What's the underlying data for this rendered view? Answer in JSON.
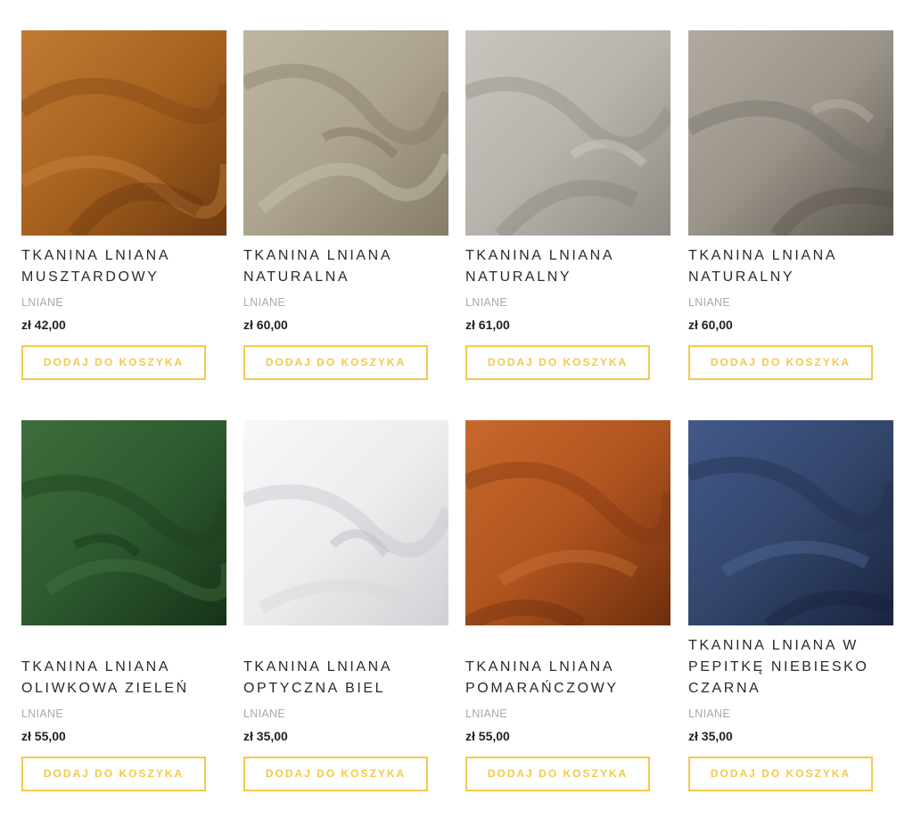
{
  "products": [
    {
      "title": "TKANINA LNIANA MUSZTARDOWY",
      "category": "LNIANE",
      "price": "zł 42,00",
      "button": "DODAJ DO KOSZYKA",
      "color": "#a8621f"
    },
    {
      "title": "TKANINA LNIANA NATURALNA",
      "category": "LNIANE",
      "price": "zł 60,00",
      "button": "DODAJ DO KOSZYKA",
      "color": "#aca48f"
    },
    {
      "title": "TKANINA LNIANA NATURALNY",
      "category": "LNIANE",
      "price": "zł 61,00",
      "button": "DODAJ DO KOSZYKA",
      "color": "#b8b4ad"
    },
    {
      "title": "TKANINA LNIANA NATURALNY",
      "category": "LNIANE",
      "price": "zł 60,00",
      "button": "DODAJ DO KOSZYKA",
      "color": "#9a948a"
    },
    {
      "title": "TKANINA LNIANA OLIWKOWA ZIELEŃ",
      "category": "LNIANE",
      "price": "zł 55,00",
      "button": "DODAJ DO KOSZYKA",
      "color": "#2e5a2f"
    },
    {
      "title": "TKANINA LNIANA OPTYCZNA BIEL",
      "category": "LNIANE",
      "price": "zł 35,00",
      "button": "DODAJ DO KOSZYKA",
      "color": "#ecedee"
    },
    {
      "title": "TKANINA LNIANA POMARAŃCZOWY",
      "category": "LNIANE",
      "price": "zł 55,00",
      "button": "DODAJ DO KOSZYKA",
      "color": "#b0541f"
    },
    {
      "title": "TKANINA LNIANA W PEPITKĘ NIEBIESKO CZARNA",
      "category": "LNIANE",
      "price": "zł 35,00",
      "button": "DODAJ DO KOSZYKA",
      "color": "#33466c"
    }
  ],
  "accent": "#f2c94c"
}
